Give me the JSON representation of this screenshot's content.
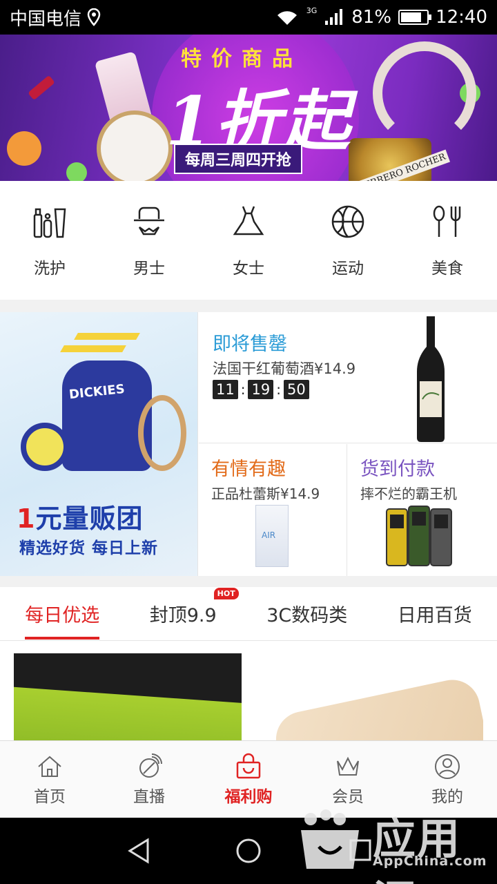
{
  "status_bar": {
    "carrier": "中国电信",
    "network": "3G",
    "battery": "81%",
    "battery_level": 0.81,
    "time": "12:40"
  },
  "banner": {
    "headline": "特价商品",
    "big_text": "1折起",
    "subtitle": "每周三周四开抢",
    "product_label": "FERRERO ROCHER"
  },
  "categories": [
    {
      "label": "洗护",
      "icon": "cosmetics-icon"
    },
    {
      "label": "男士",
      "icon": "gentleman-hat-icon"
    },
    {
      "label": "女士",
      "icon": "dress-icon"
    },
    {
      "label": "运动",
      "icon": "basketball-icon"
    },
    {
      "label": "美食",
      "icon": "utensils-icon"
    }
  ],
  "promo": {
    "left": {
      "title_accent": "1",
      "title": "元量贩团",
      "subtitle": "精选好货 每日上新",
      "bag_label": "DICKIES"
    },
    "top": {
      "title": "即将售罄",
      "desc": "法国干红葡萄酒¥14.9",
      "timer": [
        "11",
        "19",
        "50"
      ]
    },
    "bottom_left": {
      "title": "有情有趣",
      "desc": "正品杜蕾斯¥14.9",
      "product_label": "AIR"
    },
    "bottom_right": {
      "title": "货到付款",
      "desc": "摔不烂的霸王机"
    }
  },
  "tabs": [
    {
      "label": "每日优选",
      "active": true
    },
    {
      "label": "封顶9.9",
      "badge": "HOT"
    },
    {
      "label": "3C数码类"
    },
    {
      "label": "日用百货"
    }
  ],
  "bottom_nav": [
    {
      "label": "首页",
      "icon": "home-icon"
    },
    {
      "label": "直播",
      "icon": "satellite-dish-icon"
    },
    {
      "label": "福利购",
      "icon": "shopping-bag-icon",
      "active": true
    },
    {
      "label": "会员",
      "icon": "crown-icon"
    },
    {
      "label": "我的",
      "icon": "user-icon"
    }
  ],
  "watermark": {
    "cn": "应用汇",
    "en": "AppChina.com"
  },
  "colors": {
    "accent": "#e02323",
    "promo_blue": "#2a9bd6",
    "promo_orange": "#e26b1a",
    "promo_purple": "#7a54c0"
  }
}
